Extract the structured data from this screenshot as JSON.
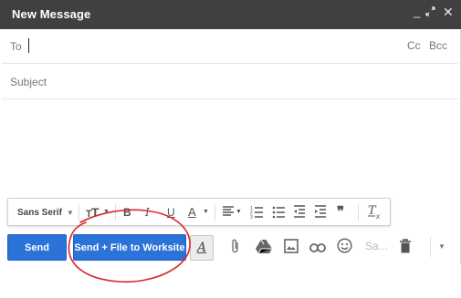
{
  "window": {
    "title": "New Message",
    "controls": {
      "minimize": "_",
      "expand": "⤢",
      "close": "✕"
    }
  },
  "fields": {
    "to_label": "To",
    "cc_label": "Cc",
    "bcc_label": "Bcc",
    "subject_placeholder": "Subject"
  },
  "format_toolbar": {
    "font": "Sans Serif",
    "buttons": [
      "text-size",
      "bold",
      "italic",
      "underline",
      "text-color",
      "align",
      "numbered-list",
      "bulleted-list",
      "indent-less",
      "indent-more",
      "quote",
      "remove-formatting"
    ]
  },
  "actions": {
    "send_label": "Send",
    "worksite_label": "Send + File to Worksite",
    "save_label": "Sa..."
  },
  "annotation": {
    "color": "#d9262b"
  }
}
